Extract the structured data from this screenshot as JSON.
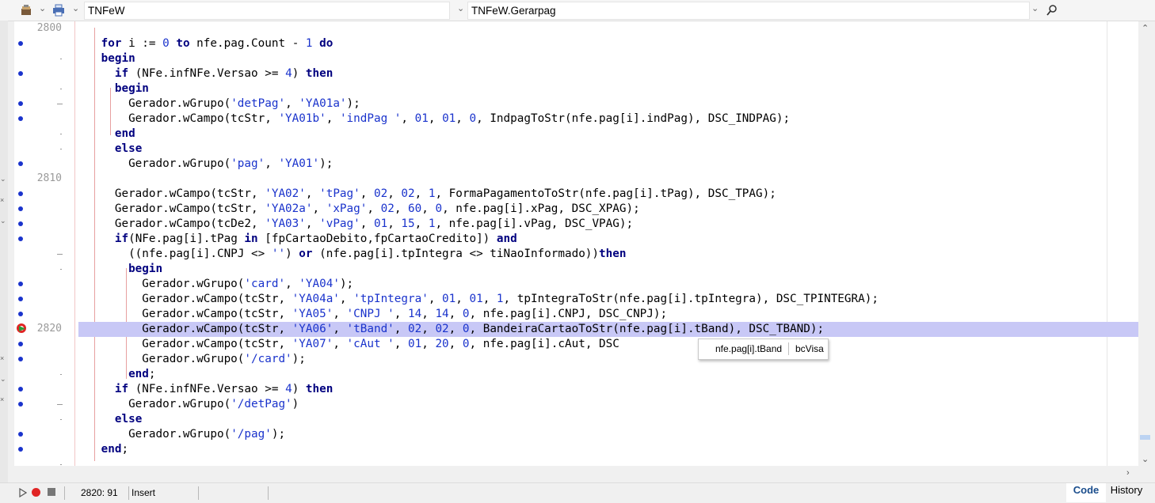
{
  "toolbar": {
    "unit_combo": "TNFeW",
    "method_combo": "TNFeW.Gerarpag"
  },
  "editor": {
    "lines": [
      {
        "num": "2800",
        "marker": "",
        "code": ""
      },
      {
        "num": "",
        "marker": "dot",
        "code": "      for i := 0 to nfe.pag.Count - 1 do"
      },
      {
        "num": "",
        "marker": "tick",
        "code": "      begin"
      },
      {
        "num": "",
        "marker": "dot",
        "code": "        if (NFe.infNFe.Versao >= 4) then"
      },
      {
        "num": "",
        "marker": "tick",
        "code": "        begin"
      },
      {
        "num": "",
        "marker": "dot-dash",
        "code": "          Gerador.wGrupo('detPag', 'YA01a');"
      },
      {
        "num": "",
        "marker": "dot",
        "code": "          Gerador.wCampo(tcStr, 'YA01b', 'indPag ', 01, 01, 0, IndpagToStr(nfe.pag[i].indPag), DSC_INDPAG);"
      },
      {
        "num": "",
        "marker": "tick",
        "code": "        end"
      },
      {
        "num": "",
        "marker": "tick",
        "code": "        else"
      },
      {
        "num": "",
        "marker": "dot",
        "code": "          Gerador.wGrupo('pag', 'YA01');"
      },
      {
        "num": "2810",
        "marker": "",
        "code": ""
      },
      {
        "num": "",
        "marker": "dot",
        "code": "        Gerador.wCampo(tcStr, 'YA02', 'tPag', 02, 02, 1, FormaPagamentoToStr(nfe.pag[i].tPag), DSC_TPAG);"
      },
      {
        "num": "",
        "marker": "dot",
        "code": "        Gerador.wCampo(tcStr, 'YA02a', 'xPag', 02, 60, 0, nfe.pag[i].xPag, DSC_XPAG);"
      },
      {
        "num": "",
        "marker": "dot",
        "code": "        Gerador.wCampo(tcDe2, 'YA03', 'vPag', 01, 15, 1, nfe.pag[i].vPag, DSC_VPAG);"
      },
      {
        "num": "",
        "marker": "dot",
        "code": "        if(NFe.pag[i].tPag in [fpCartaoDebito,fpCartaoCredito]) and"
      },
      {
        "num": "",
        "marker": "dash",
        "code": "          ((nfe.pag[i].CNPJ <> '') or (nfe.pag[i].tpIntegra <> tiNaoInformado))then"
      },
      {
        "num": "",
        "marker": "tick",
        "code": "          begin"
      },
      {
        "num": "",
        "marker": "dot",
        "code": "            Gerador.wGrupo('card', 'YA04');"
      },
      {
        "num": "",
        "marker": "dot",
        "code": "            Gerador.wCampo(tcStr, 'YA04a', 'tpIntegra', 01, 01, 1, tpIntegraToStr(nfe.pag[i].tpIntegra), DSC_TPINTEGRA);"
      },
      {
        "num": "",
        "marker": "dot",
        "code": "            Gerador.wCampo(tcStr, 'YA05', 'CNPJ ', 14, 14, 0, nfe.pag[i].CNPJ, DSC_CNPJ);"
      },
      {
        "num": "2820",
        "marker": "bp",
        "code": "            Gerador.wCampo(tcStr, 'YA06', 'tBand', 02, 02, 0, BandeiraCartaoToStr(nfe.pag[i].tBand), DSC_TBAND);"
      },
      {
        "num": "",
        "marker": "dot",
        "code": "            Gerador.wCampo(tcStr, 'YA07', 'cAut ', 01, 20, 0, nfe.pag[i].cAut, DSC"
      },
      {
        "num": "",
        "marker": "dot",
        "code": "            Gerador.wGrupo('/card');"
      },
      {
        "num": "",
        "marker": "tick",
        "code": "          end;"
      },
      {
        "num": "",
        "marker": "dot",
        "code": "        if (NFe.infNFe.Versao >= 4) then"
      },
      {
        "num": "",
        "marker": "dot-dash",
        "code": "          Gerador.wGrupo('/detPag')"
      },
      {
        "num": "",
        "marker": "tick",
        "code": "        else"
      },
      {
        "num": "",
        "marker": "dot",
        "code": "          Gerador.wGrupo('/pag');"
      },
      {
        "num": "",
        "marker": "dot",
        "code": "      end;"
      },
      {
        "num": "",
        "marker": "tick",
        "code": ""
      }
    ],
    "current_line_index": 20
  },
  "tooltip": {
    "expression": "nfe.pag[i].tBand",
    "value": "bcVisa"
  },
  "status": {
    "position": "2820: 91",
    "mode": "Insert",
    "tab_code": "Code",
    "tab_history": "History"
  },
  "colors": {
    "keyword": "#00007f",
    "string": "#1a33cc",
    "number": "#1a33cc",
    "current_line": "#c8c8f6",
    "breakpoint_dot": "#1a33cc"
  }
}
